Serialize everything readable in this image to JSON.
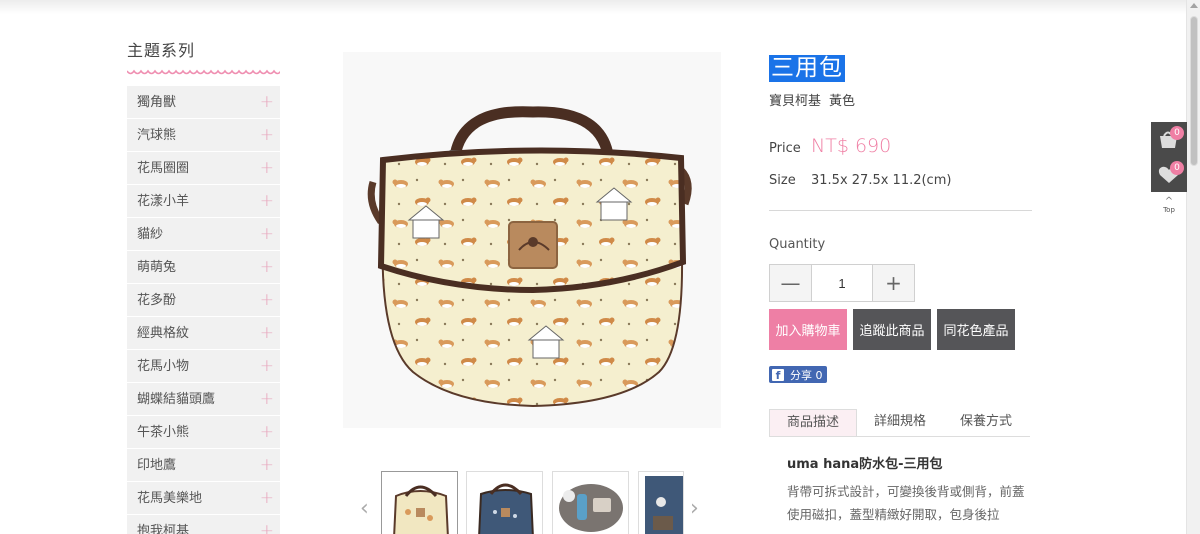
{
  "sidebar": {
    "title": "主題系列",
    "items": [
      {
        "label": "獨角獸"
      },
      {
        "label": "汽球熊"
      },
      {
        "label": "花馬圈圈"
      },
      {
        "label": "花漾小羊"
      },
      {
        "label": "貓紗"
      },
      {
        "label": "萌萌兔"
      },
      {
        "label": "花多酚"
      },
      {
        "label": "經典格紋"
      },
      {
        "label": "花馬小物"
      },
      {
        "label": "蝴蝶結貓頭鷹"
      },
      {
        "label": "午茶小熊"
      },
      {
        "label": "印地鷹"
      },
      {
        "label": "花馬美樂地"
      },
      {
        "label": "抱我柯基"
      }
    ],
    "plus_symbol": "+"
  },
  "product": {
    "title": "三用包",
    "series": "寶貝柯基",
    "color": "黃色",
    "price_label": "Price",
    "price": "NT$ 690",
    "size_label": "Size",
    "size": "31.5x 27.5x 11.2(cm)",
    "quantity_label": "Quantity",
    "quantity": "1",
    "minus": "—",
    "plus": "+",
    "buttons": {
      "add_to_cart": "加入購物車",
      "track": "追蹤此商品",
      "same_pattern": "同花色產品"
    },
    "share": {
      "icon": "f",
      "label": "分享 0"
    },
    "tabs": [
      "商品描述",
      "詳細規格",
      "保養方式"
    ],
    "desc_title": "uma hana防水包-三用包",
    "desc_body": "背帶可拆式設計，可變換後背或側背，前蓋使用磁扣，蓋型精緻好開取，包身後拉"
  },
  "floating": {
    "cart_count": "0",
    "wish_count": "0",
    "top_label": "Top",
    "cart_icon": "cart-icon",
    "heart_icon": "heart-icon"
  },
  "colors": {
    "accent_pink": "#ee7fa5",
    "dark_button": "#555558",
    "selection_blue": "#1a73e8"
  }
}
